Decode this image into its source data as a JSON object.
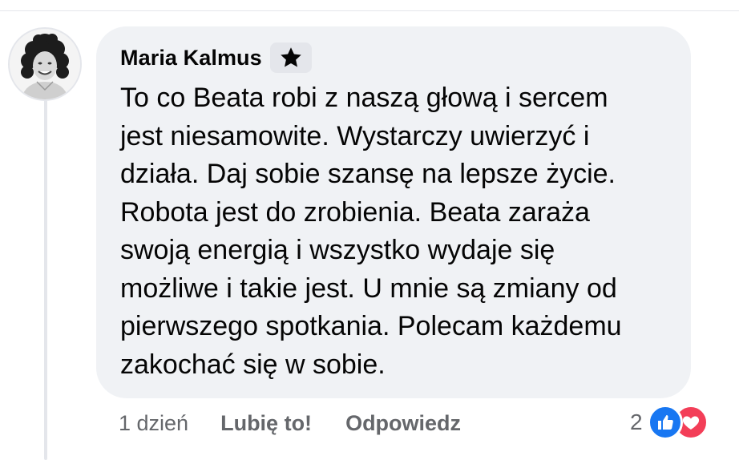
{
  "comment": {
    "author": "Maria Kalmus",
    "badge_icon": "star-icon",
    "text": "To co Beata robi z naszą głową i sercem\njest niesamowite. Wystarczy uwierzyć i\ndziała. Daj sobie szansę na lepsze życie.\nRobota jest do zrobienia. Beata zaraża\nswoją energią i wszystko wydaje się\nmożliwe i takie jest. U mnie są zmiany od\npierwszego spotkania. Polecam każdemu\nzakochać się w sobie."
  },
  "actions": {
    "time": "1 dzień",
    "like_label": "Lubię to!",
    "reply_label": "Odpowiedz"
  },
  "reactions": {
    "count": "2",
    "icons": [
      "thumbs-up-icon",
      "heart-icon"
    ],
    "colors": {
      "like": "#1877f2",
      "love": "#f33e58"
    }
  }
}
